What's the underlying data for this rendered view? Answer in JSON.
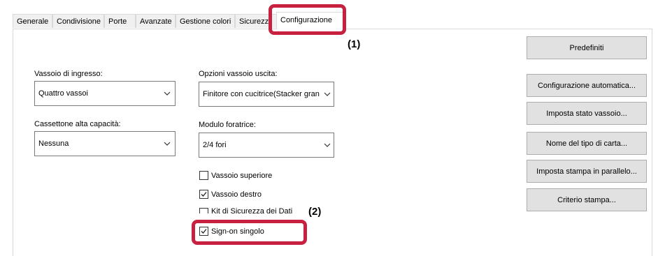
{
  "tabs": [
    {
      "label": "Generale"
    },
    {
      "label": "Condivisione"
    },
    {
      "label": "Porte"
    },
    {
      "label": "Avanzate"
    },
    {
      "label": "Gestione colori"
    },
    {
      "label": "Sicurezz"
    },
    {
      "label": "Configurazione"
    }
  ],
  "callouts": {
    "one": "(1)",
    "two": "(2)"
  },
  "fields": {
    "input_tray": {
      "label": "Vassoio di ingresso:",
      "value": "Quattro vassoi"
    },
    "output_tray": {
      "label": "Opzioni vassoio uscita:",
      "value": "Finitore con cucitrice(Stacker gran"
    },
    "high_capacity": {
      "label": "Cassettone alta capacità:",
      "value": "Nessuna"
    },
    "punch_module": {
      "label": "Modulo foratrice:",
      "value": "2/4 fori"
    }
  },
  "checkboxes": [
    {
      "label": "Vassoio superiore",
      "checked": false
    },
    {
      "label": "Vassoio destro",
      "checked": true
    },
    {
      "label": "Kit di Sicurezza dei Dati",
      "checked": false
    },
    {
      "label": "Sign-on singolo",
      "checked": true
    }
  ],
  "buttons": {
    "defaults": "Predefiniti",
    "auto_config": "Configurazione automatica...",
    "tray_status": "Imposta stato vassoio...",
    "paper_type_name": "Nome del tipo di carta...",
    "parallel_print": "Imposta stampa in parallelo...",
    "print_policy": "Criterio stampa..."
  },
  "colors": {
    "highlight": "#c8203f"
  }
}
